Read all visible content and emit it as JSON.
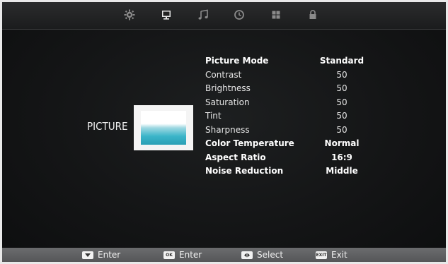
{
  "tabs": [
    {
      "id": "settings",
      "icon": "gear-icon",
      "active": false
    },
    {
      "id": "picture",
      "icon": "monitor-icon",
      "active": true
    },
    {
      "id": "sound",
      "icon": "music-note-icon",
      "active": false
    },
    {
      "id": "time",
      "icon": "clock-icon",
      "active": false
    },
    {
      "id": "options",
      "icon": "grid-icon",
      "active": false
    },
    {
      "id": "lock",
      "icon": "lock-icon",
      "active": false
    }
  ],
  "menu": {
    "title": "PICTURE"
  },
  "settings": [
    {
      "label": "Picture Mode",
      "value": "Standard"
    },
    {
      "label": "Contrast",
      "value": "50"
    },
    {
      "label": "Brightness",
      "value": "50"
    },
    {
      "label": "Saturation",
      "value": "50"
    },
    {
      "label": "Tint",
      "value": "50"
    },
    {
      "label": "Sharpness",
      "value": "50"
    },
    {
      "label": "Color Temperature",
      "value": "Normal"
    },
    {
      "label": "Aspect Ratio",
      "value": "16:9"
    },
    {
      "label": "Noise Reduction",
      "value": "Middle"
    }
  ],
  "footer": {
    "hints": [
      {
        "key_icon": "down-arrow-key-icon",
        "key_text": "",
        "label": "Enter"
      },
      {
        "key_icon": "ok-key-icon",
        "key_text": "OK",
        "label": "Enter"
      },
      {
        "key_icon": "left-right-key-icon",
        "key_text": "",
        "label": "Select"
      },
      {
        "key_icon": "exit-key-icon",
        "key_text": "EXIT",
        "label": "Exit"
      }
    ]
  }
}
